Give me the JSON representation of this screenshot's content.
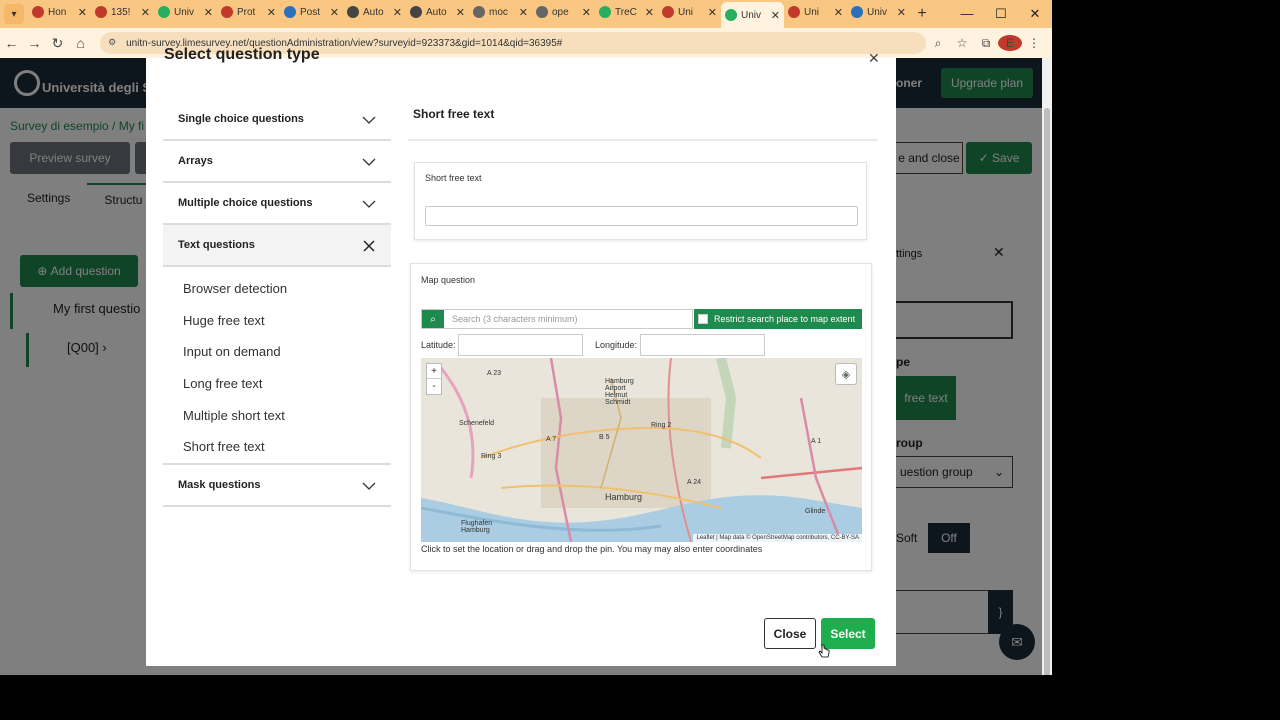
{
  "browser": {
    "tabs": [
      {
        "label": "Hon",
        "color": "#c0392b"
      },
      {
        "label": "135!",
        "color": "#c0392b"
      },
      {
        "label": "Univ",
        "color": "#27ae60"
      },
      {
        "label": "Prot",
        "color": "#c0392b"
      },
      {
        "label": "Post",
        "color": "#2c6fbb"
      },
      {
        "label": "Auto",
        "color": "#444444"
      },
      {
        "label": "Auto",
        "color": "#444444"
      },
      {
        "label": "moc",
        "color": "#666666"
      },
      {
        "label": "ope",
        "color": "#666666"
      },
      {
        "label": "TreC",
        "color": "#27ae60"
      },
      {
        "label": "Uni",
        "color": "#c0392b"
      },
      {
        "label": "Univ",
        "color": "#27ae60"
      },
      {
        "label": "Uni",
        "color": "#c0392b"
      },
      {
        "label": "Univ",
        "color": "#2c6fbb"
      }
    ],
    "active_tab_index": 11,
    "url": "unitn-survey.limesurvey.net/questionAdministration/view?surveyid=923373&gid=1014&qid=36395#",
    "profile_initial": "E"
  },
  "page": {
    "university": "Università degli St",
    "header_user": "oner",
    "upgrade_label": "Upgrade plan",
    "breadcrumb": "Survey di esempio  /  My fi",
    "preview_label": "Preview survey",
    "save_close_label": "e and close",
    "save_label": "Save",
    "tabs": [
      "Settings",
      "Structu"
    ],
    "add_question_label": "Add question",
    "tree_group": "My first questio",
    "tree_question": "[Q00] ›",
    "side_panel_title": "ttings",
    "qtype_label": "pe",
    "qtype_value": "free text",
    "group_label": "roup",
    "group_value": "uestion group",
    "soft_label": "Soft",
    "off_label": "Off",
    "brace_label": "}"
  },
  "modal": {
    "title": "Select question type",
    "categories": [
      {
        "label": "Single choice questions",
        "open": false
      },
      {
        "label": "Arrays",
        "open": false
      },
      {
        "label": "Multiple choice questions",
        "open": false
      },
      {
        "label": "Text questions",
        "open": true
      },
      {
        "label": "Mask questions",
        "open": false
      }
    ],
    "text_questions": [
      "Browser detection",
      "Huge free text",
      "Input on demand",
      "Long free text",
      "Multiple short text",
      "Short free text"
    ],
    "preview_title": "Short free text",
    "preview": {
      "short_text_label": "Short free text",
      "map_label": "Map question",
      "search_placeholder": "Search (3 characters minimum)",
      "restrict_label": "Restrict search place to map extent",
      "latitude_label": "Latitude:",
      "longitude_label": "Longitude:",
      "zoom_in": "+",
      "zoom_out": "-",
      "map_places": [
        "A 23",
        "Hamburg Airport Helmut Schmidt",
        "Schenefeld",
        "A 7",
        "B 5",
        "Ring 2",
        "Ring 3",
        "Hamburg",
        "A 24",
        "A 1",
        "Glinde",
        "Flughafen Hamburg"
      ],
      "attribution": "Leaflet | Map data © OpenStreetMap contributors, CC-BY-SA",
      "caption": "Click to set the location or drag and drop the pin. You may may also enter coordinates"
    },
    "close_label": "Close",
    "select_label": "Select"
  },
  "colors": {
    "brand_green": "#1f8a4d",
    "select_green": "#1fae4d",
    "header_dark": "#1d2d3a",
    "tabbar": "#f9c781"
  }
}
